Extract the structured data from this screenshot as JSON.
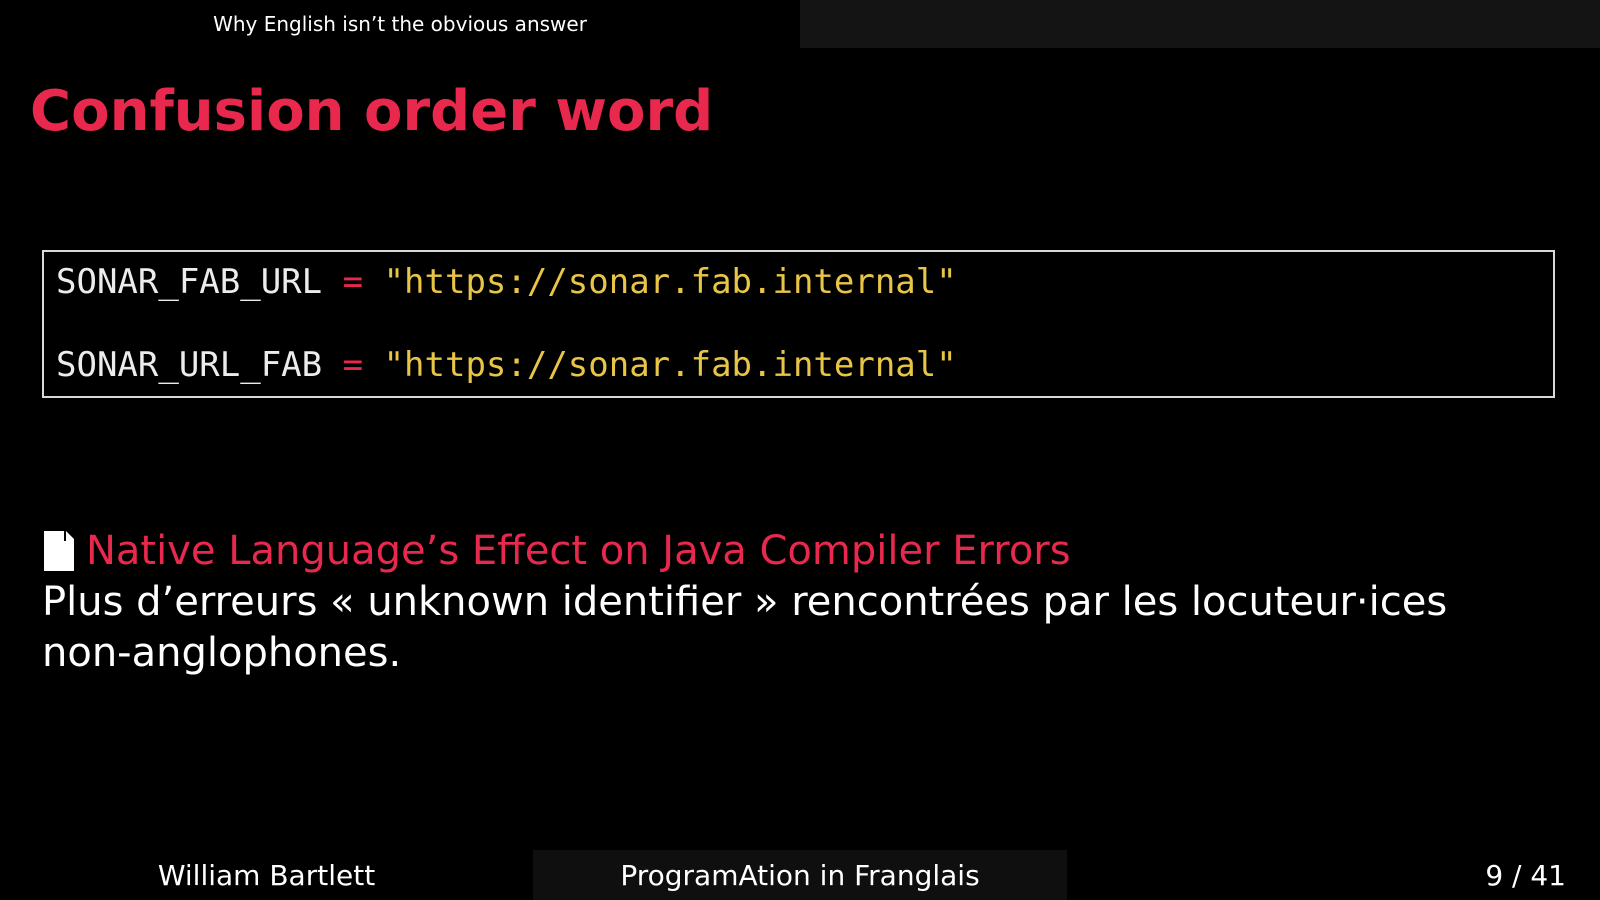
{
  "header": {
    "section_title": "Why English isn’t the obvious answer"
  },
  "slide": {
    "title": "Confusion order word"
  },
  "code": {
    "lines": [
      {
        "name": "SONAR_FAB_URL",
        "op": "=",
        "value": "\"https://sonar.fab.internal\""
      },
      {
        "name": "SONAR_URL_FAB",
        "op": "=",
        "value": "\"https://sonar.fab.internal\""
      }
    ]
  },
  "reference": {
    "icon": "file-icon",
    "link_text": "Native Language’s Effect on Java Compiler Errors",
    "summary": "Plus d’erreurs « unknown identifier » rencontrées par les locuteur·ices non-anglophones."
  },
  "footer": {
    "author": "William Bartlett",
    "talk_title": "ProgramAtion in Franglais",
    "page": "9 / 41"
  },
  "colors": {
    "accent": "#e8284d",
    "string": "#e8c547",
    "background": "#000000",
    "text": "#ffffff"
  }
}
